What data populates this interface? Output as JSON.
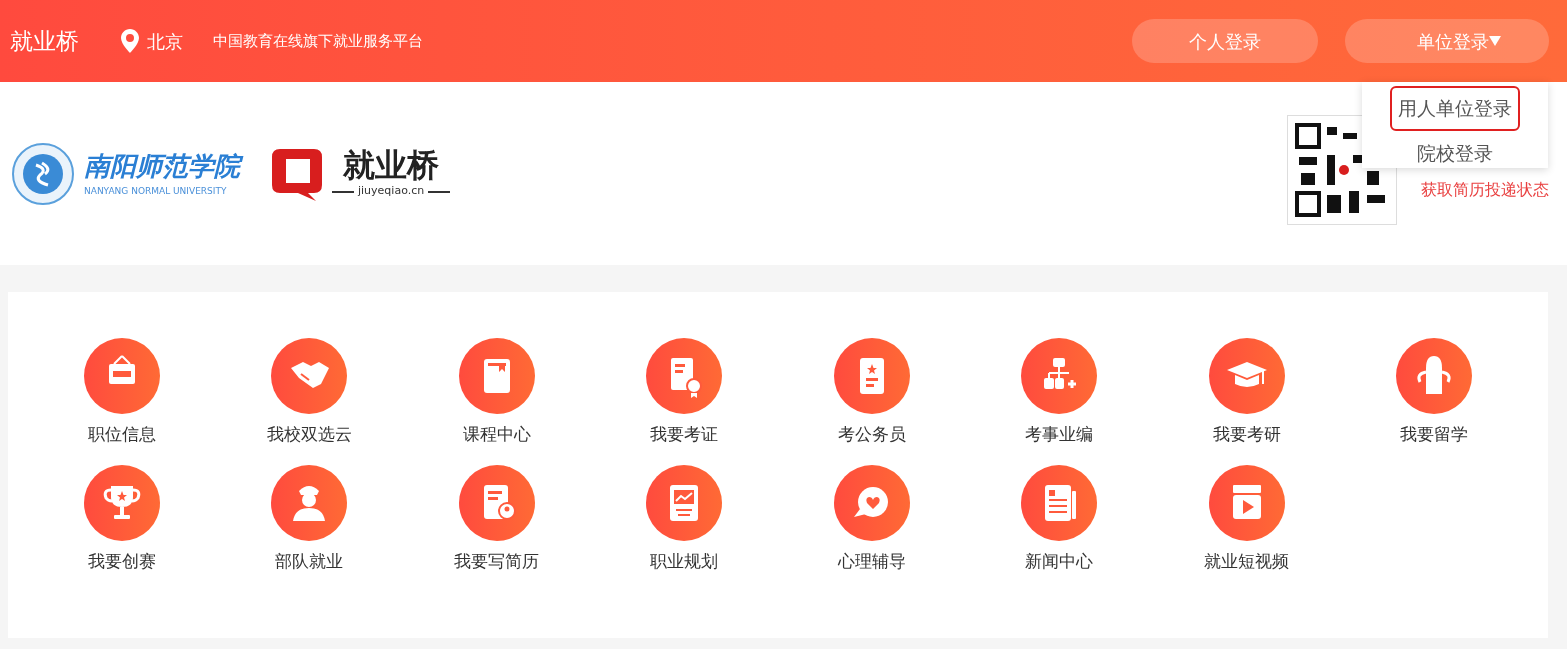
{
  "top_bar": {
    "brand": "就业桥",
    "city": "北京",
    "slogan": "中国教育在线旗下就业服务平台",
    "buttons": [
      {
        "label": "个人登录",
        "kind": "plain"
      },
      {
        "label": "单位登录",
        "kind": "dropdown"
      }
    ]
  },
  "login_menu": {
    "items": [
      {
        "label": "用人单位登录",
        "highlighted": true
      },
      {
        "label": "院校登录",
        "highlighted": false
      }
    ]
  },
  "logos": {
    "university_name": "南阳师范学院",
    "university_english": "NANYANG NORMAL UNIVERSITY",
    "platform_name": "就业桥",
    "platform_domain": "jiuyeqiao.cn"
  },
  "qr_panel": {
    "link": "获取简历投递状态"
  },
  "services": [
    {
      "label": "职位信息"
    },
    {
      "label": "我校双选云"
    },
    {
      "label": "课程中心"
    },
    {
      "label": "我要考证"
    },
    {
      "label": "考公务员"
    },
    {
      "label": "考事业编"
    },
    {
      "label": "我要考研"
    },
    {
      "label": "我要留学"
    },
    {
      "label": "我要创赛"
    },
    {
      "label": "部队就业"
    },
    {
      "label": "我要写简历"
    },
    {
      "label": "职业规划"
    },
    {
      "label": "心理辅导"
    },
    {
      "label": "新闻中心"
    },
    {
      "label": "就业短视频"
    }
  ]
}
